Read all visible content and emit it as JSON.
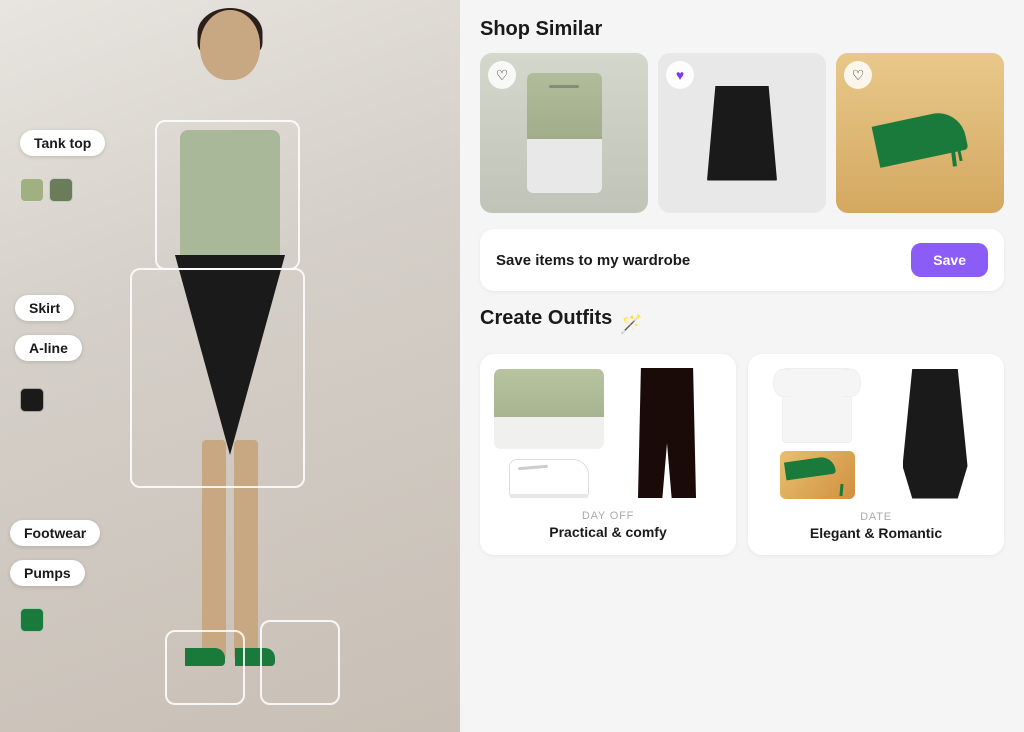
{
  "left": {
    "labels": {
      "tank_top": "Tank top",
      "skirt": "Skirt",
      "aline": "A-line",
      "footwear": "Footwear",
      "pumps": "Pumps"
    },
    "swatches": {
      "tank": [
        "#a0b080",
        "#6a7c5a"
      ],
      "skirt": [
        "#1a1a1a"
      ],
      "footwear": [
        "#1a7a3c"
      ]
    }
  },
  "right": {
    "shop_similar": {
      "title": "Shop Similar",
      "products": [
        {
          "id": 1,
          "type": "tank_top",
          "liked": false
        },
        {
          "id": 2,
          "type": "skirt",
          "liked": true
        },
        {
          "id": 3,
          "type": "heels",
          "liked": false
        }
      ]
    },
    "wardrobe": {
      "text": "Save items to my wardrobe",
      "button_label": "Save"
    },
    "create_outfits": {
      "title": "Create Outfits",
      "outfits": [
        {
          "id": 1,
          "category": "DAY OFF",
          "name": "Practical & comfy"
        },
        {
          "id": 2,
          "category": "DATE",
          "name": "Elegant & Romantic"
        }
      ]
    }
  }
}
